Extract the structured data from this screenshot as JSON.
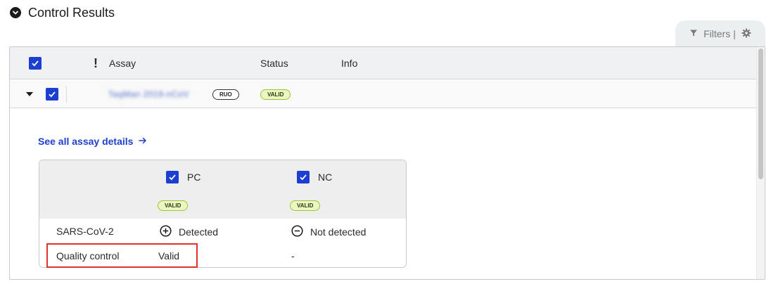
{
  "section": {
    "title": "Control Results"
  },
  "filters": {
    "label": "Filters",
    "separator": "|",
    "icon": "filter-icon",
    "settings_icon": "gear-icon"
  },
  "table": {
    "columns": {
      "flag": "!",
      "assay": "Assay",
      "status": "Status",
      "info": "Info"
    },
    "rows": [
      {
        "assay_name": "TaqMan 2019-nCoV",
        "tag": "RUO",
        "status": "VALID",
        "details_link": "See all assay details",
        "controls": {
          "columns": [
            {
              "name": "PC",
              "status": "VALID"
            },
            {
              "name": "NC",
              "status": "VALID"
            }
          ],
          "rows": [
            {
              "label": "SARS-CoV-2",
              "pc": "Detected",
              "nc": "Not detected"
            },
            {
              "label": "Quality control",
              "pc": "Valid",
              "nc": "-"
            }
          ]
        }
      }
    ]
  },
  "colors": {
    "accent": "#1d3fd1",
    "valid_bg": "#eaf7c2",
    "valid_border": "#9ec232",
    "highlight": "#e0312b",
    "header_bg": "#eff1f3"
  }
}
